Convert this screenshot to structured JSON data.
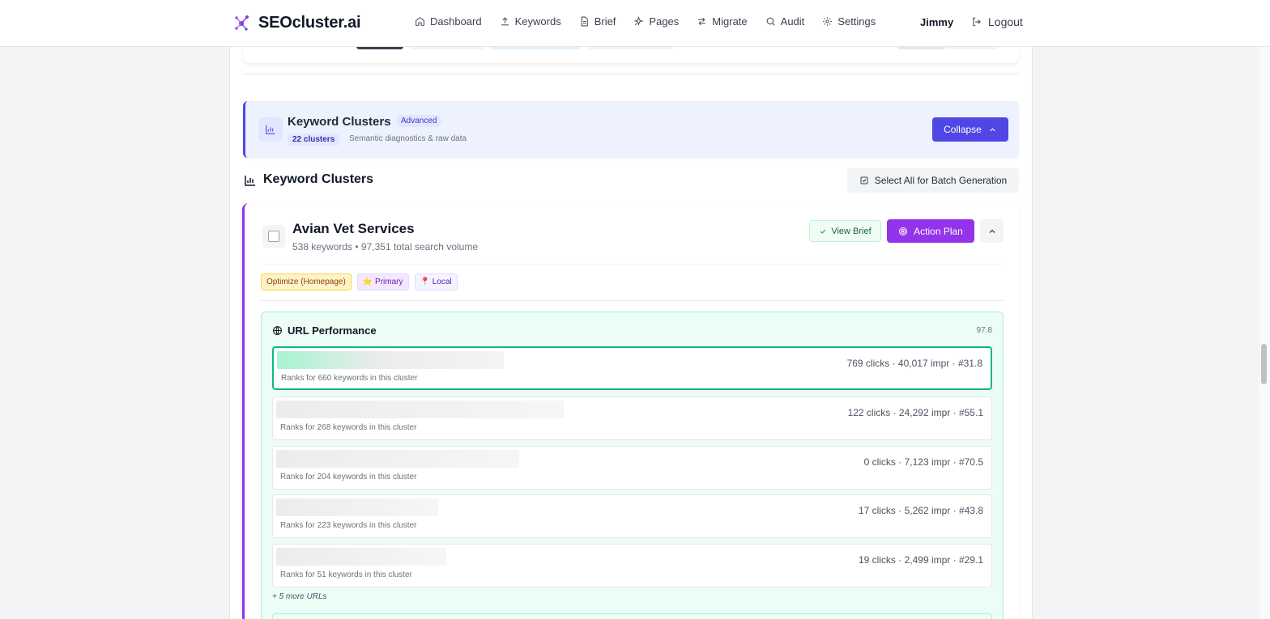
{
  "brand": {
    "name": "SEOcluster.ai"
  },
  "nav": {
    "items": [
      {
        "label": "Dashboard",
        "icon": "home-icon"
      },
      {
        "label": "Keywords",
        "icon": "upload-icon"
      },
      {
        "label": "Brief",
        "icon": "document-icon"
      },
      {
        "label": "Pages",
        "icon": "sparkle-icon"
      },
      {
        "label": "Migrate",
        "icon": "arrows-icon"
      },
      {
        "label": "Audit",
        "icon": "search-icon"
      },
      {
        "label": "Settings",
        "icon": "gear-icon"
      }
    ],
    "user": "Jimmy",
    "logout": "Logout"
  },
  "advanced": {
    "title": "Keyword Clusters",
    "badge": "Advanced",
    "count": "22 clusters",
    "subtitle": "Semantic diagnostics & raw data",
    "collapse_label": "Collapse"
  },
  "section": {
    "title": "Keyword Clusters",
    "select_all_label": "Select All for Batch Generation"
  },
  "cluster": {
    "name": "Avian Vet Services",
    "meta": "538 keywords • 97,351 total search volume",
    "view_brief_label": "View Brief",
    "action_plan_label": "Action Plan",
    "tags": [
      "Optimize (Homepage)",
      "⭐ Primary",
      "📍 Local"
    ]
  },
  "url_performance": {
    "title": "URL Performance",
    "score": "97.8",
    "rows": [
      {
        "stats": "769 clicks · 40,017 impr · #31.8",
        "rank": "Ranks for 660 keywords in this cluster"
      },
      {
        "stats": "122 clicks · 24,292 impr · #55.1",
        "rank": "Ranks for 268 keywords in this cluster"
      },
      {
        "stats": "0 clicks · 7,123 impr · #70.5",
        "rank": "Ranks for 204 keywords in this cluster"
      },
      {
        "stats": "17 clicks · 5,262 impr · #43.8",
        "rank": "Ranks for 223 keywords in this cluster"
      },
      {
        "stats": "19 clicks · 2,499 impr · #29.1",
        "rank": "Ranks for 51 keywords in this cluster"
      }
    ],
    "more": "+ 5 more URLs"
  },
  "colors": {
    "primary": "#4f46e5",
    "purple": "#9333ea",
    "green": "#10b981"
  }
}
